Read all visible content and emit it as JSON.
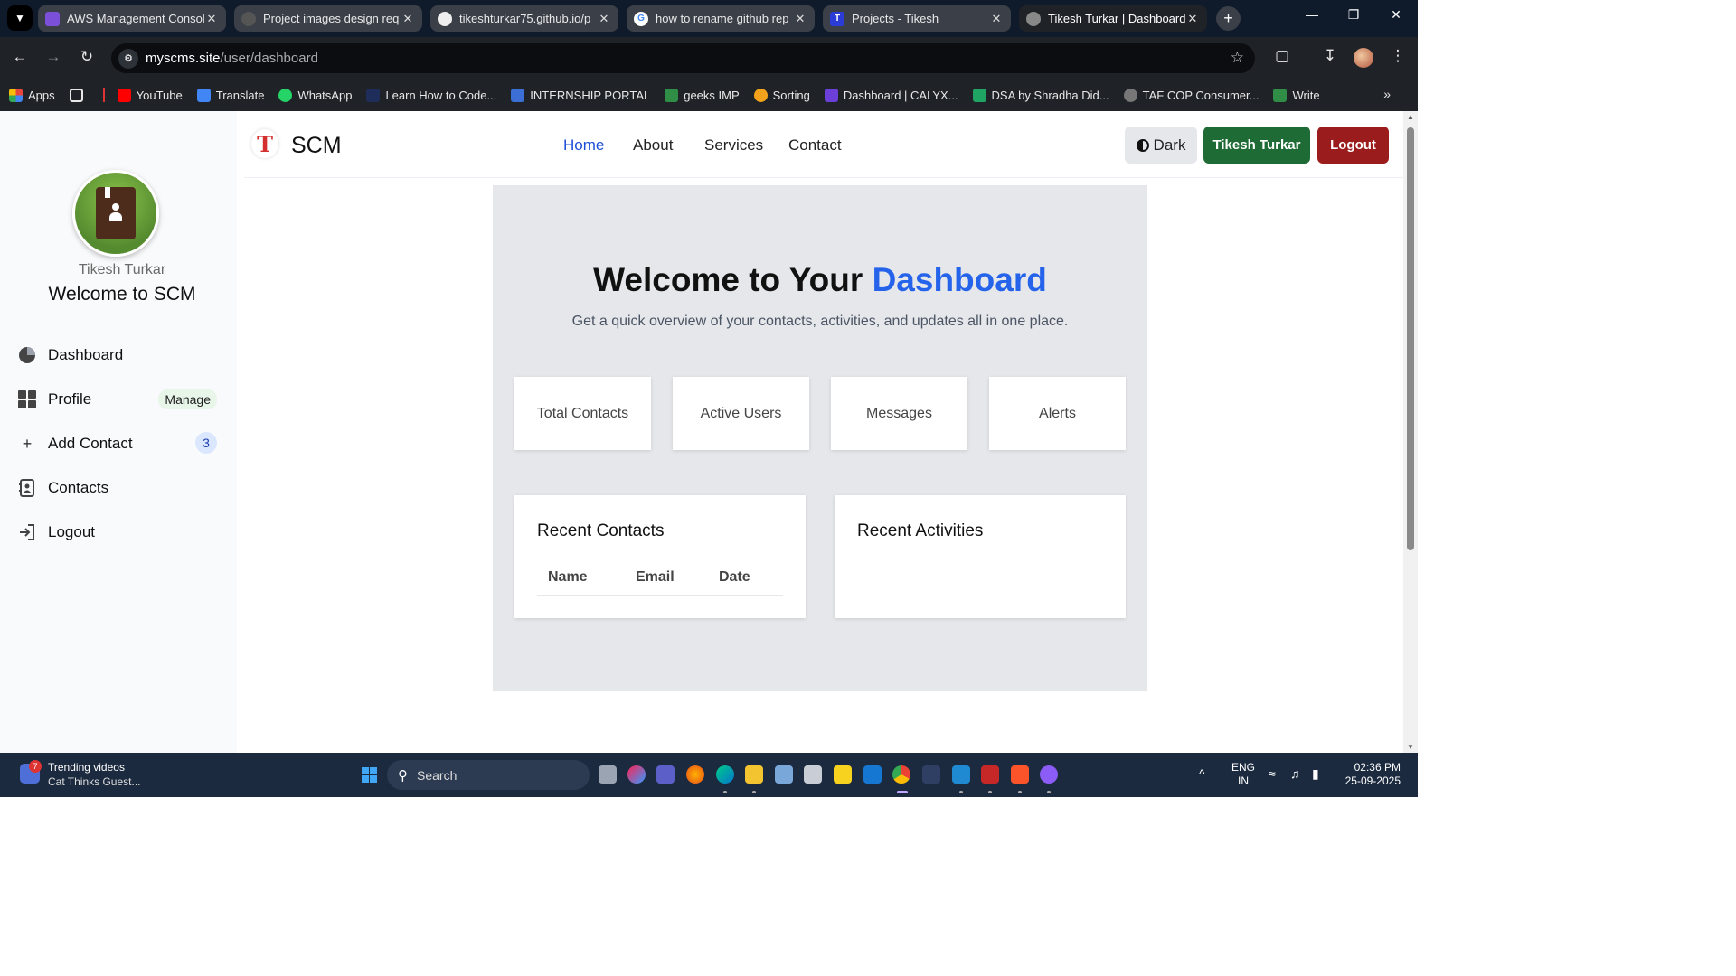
{
  "browser": {
    "tabs": [
      {
        "title": "AWS Management Console",
        "active": false,
        "favicon_color": "#7b4fd8"
      },
      {
        "title": "Project images design req",
        "active": false,
        "favicon_color": "#555"
      },
      {
        "title": "tikeshturkar75.github.io/p",
        "active": false,
        "favicon_color": "#333"
      },
      {
        "title": "how to rename github rep",
        "active": false,
        "favicon_color": "#4285f4"
      },
      {
        "title": "Projects - Tikesh",
        "active": false,
        "favicon_color": "#2b3bd6"
      },
      {
        "title": "Tikesh Turkar | Dashboard",
        "active": true,
        "favicon_color": "#666"
      }
    ],
    "url_host": "myscms.site",
    "url_path": "/user/dashboard",
    "bookmarks": [
      {
        "label": "Apps",
        "color": "#e8453c"
      },
      {
        "label": "YouTube",
        "color": "#ff0000"
      },
      {
        "label": "Translate",
        "color": "#4285f4"
      },
      {
        "label": "WhatsApp",
        "color": "#25d366"
      },
      {
        "label": "Learn How to Code...",
        "color": "#1f2d5a"
      },
      {
        "label": "INTERNSHIP PORTAL",
        "color": "#3b6fd6"
      },
      {
        "label": "geeks IMP",
        "color": "#2f8d46"
      },
      {
        "label": "Sorting",
        "color": "#f4a21b"
      },
      {
        "label": "Dashboard | CALYX...",
        "color": "#6b3fd8"
      },
      {
        "label": "DSA by Shradha Did...",
        "color": "#1fa463"
      },
      {
        "label": "TAF COP Consumer...",
        "color": "#777"
      },
      {
        "label": "Write",
        "color": "#2f8d46"
      }
    ]
  },
  "sidebar": {
    "user_name": "Tikesh Turkar",
    "welcome": "Welcome to SCM",
    "items": [
      {
        "label": "Dashboard",
        "icon": "pie-chart-icon",
        "badge": ""
      },
      {
        "label": "Profile",
        "icon": "grid-icon",
        "badge": "Manage"
      },
      {
        "label": "Add Contact",
        "icon": "plus-icon",
        "badge": "3"
      },
      {
        "label": "Contacts",
        "icon": "contact-card-icon",
        "badge": ""
      },
      {
        "label": "Logout",
        "icon": "logout-icon",
        "badge": ""
      }
    ]
  },
  "navbar": {
    "brand": "SCM",
    "links": [
      "Home",
      "About",
      "Services",
      "Contact"
    ],
    "active_link": "Home",
    "dark_label": "Dark",
    "user_button": "Tikesh Turkar",
    "logout_button": "Logout"
  },
  "dashboard": {
    "title_part1": "Welcome to Your ",
    "title_part2": "Dashboard",
    "subtitle": "Get a quick overview of your contacts, activities, and updates all in one place.",
    "stats": [
      "Total Contacts",
      "Active Users",
      "Messages",
      "Alerts"
    ],
    "recent_contacts_title": "Recent Contacts",
    "recent_contacts_columns": [
      "Name",
      "Email",
      "Date"
    ],
    "recent_activities_title": "Recent Activities"
  },
  "taskbar": {
    "widget_badge": "7",
    "widget_line1": "Trending videos",
    "widget_line2": "Cat Thinks Guest...",
    "search_placeholder": "Search",
    "lang_line1": "ENG",
    "lang_line2": "IN",
    "time": "02:36 PM",
    "date": "25-09-2025"
  },
  "colors": {
    "accent": "#2563eb",
    "user_button": "#1f6b35",
    "logout_button": "#9b1c1c"
  }
}
